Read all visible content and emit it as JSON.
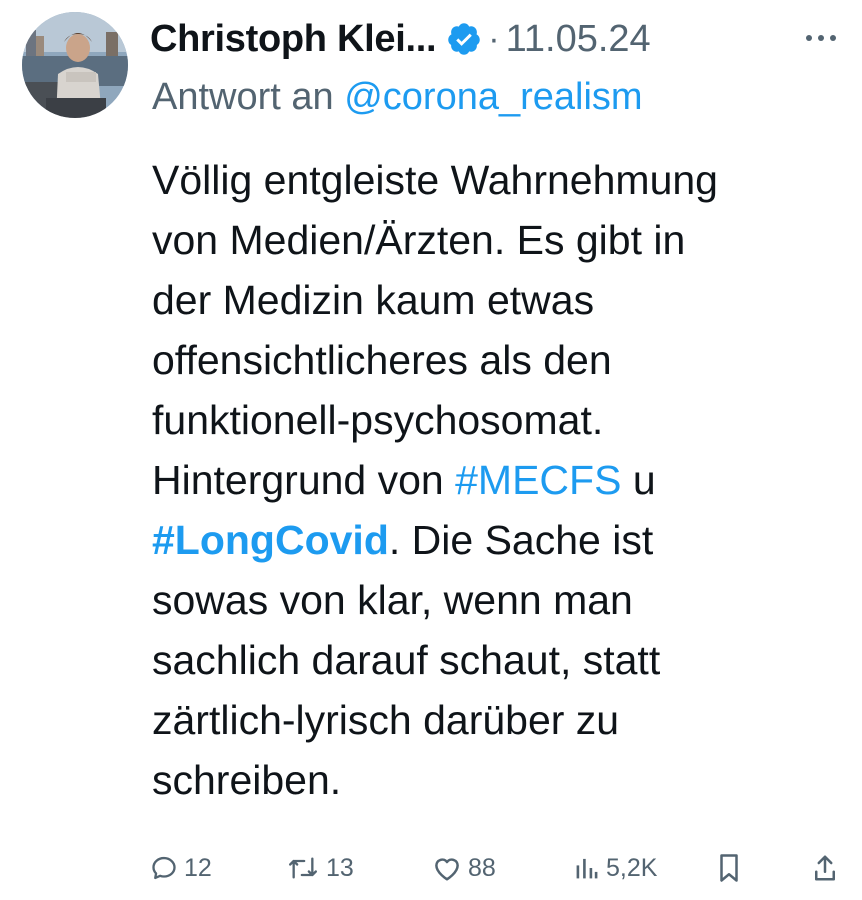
{
  "tweet": {
    "author_name": "Christoph Klei...",
    "verified": true,
    "separator": "·",
    "date": "11.05.24",
    "reply_prefix": "Antwort an",
    "reply_handle": "@corona_realism",
    "body": {
      "line1": "Völlig entgleiste Wahrnehmung",
      "line2": "von Medien/Ärzten. Es gibt in",
      "line3": "der Medizin kaum etwas",
      "line4": "offensichtlicheres als den",
      "line5": "funktionell-psychosomat.",
      "line6_pre": "Hintergrund von ",
      "hashtag1": "#MECFS",
      "line6_post": " u",
      "hashtag2": "#LongCovid",
      "line7_post": ". Die Sache ist",
      "line8": "sowas von klar, wenn man",
      "line9": "sachlich darauf schaut, statt",
      "line10": "zärtlich-lyrisch darüber zu",
      "line11": "schreiben."
    },
    "actions": {
      "replies": "12",
      "retweets": "13",
      "likes": "88",
      "views": "5,2K"
    },
    "colors": {
      "link": "#1d9bf0",
      "text": "#0f1419",
      "muted": "#536471"
    }
  }
}
